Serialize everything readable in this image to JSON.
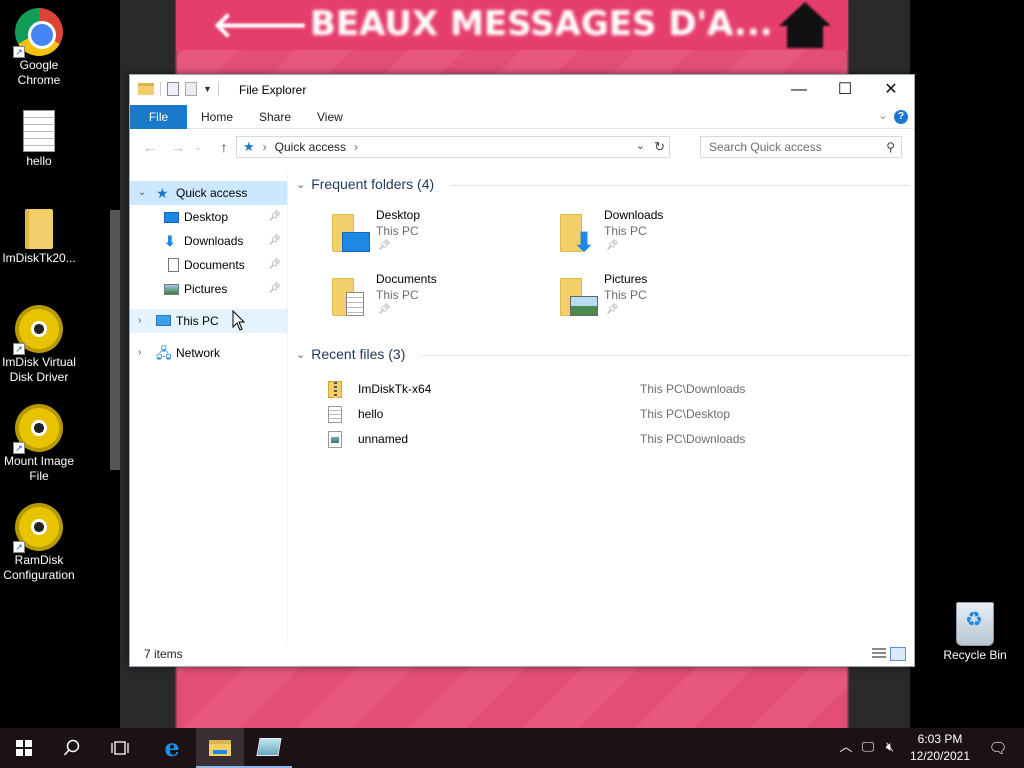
{
  "background": {
    "title": "BEAUX MESSAGES D'A...",
    "back_arrow": "🡐"
  },
  "desktop_icons": [
    {
      "label": "Google Chrome"
    },
    {
      "label": "hello"
    },
    {
      "label": "ImDiskTk20..."
    },
    {
      "label": "ImDisk Virtual Disk Driver"
    },
    {
      "label": "Mount Image File"
    },
    {
      "label": "RamDisk Configuration"
    },
    {
      "label": "Recycle Bin"
    }
  ],
  "window": {
    "title": "File Explorer",
    "ribbon_tabs": [
      "File",
      "Home",
      "Share",
      "View"
    ],
    "address_location": "Quick access",
    "search_placeholder": "Search Quick access",
    "nav_pane": {
      "quick_access": "Quick access",
      "pinned": [
        "Desktop",
        "Downloads",
        "Documents",
        "Pictures"
      ],
      "this_pc": "This PC",
      "network": "Network"
    },
    "frequent_header": "Frequent folders (4)",
    "frequent_folders": [
      {
        "name": "Desktop",
        "location": "This PC"
      },
      {
        "name": "Downloads",
        "location": "This PC"
      },
      {
        "name": "Documents",
        "location": "This PC"
      },
      {
        "name": "Pictures",
        "location": "This PC"
      }
    ],
    "recent_header": "Recent files (3)",
    "recent_files": [
      {
        "name": "ImDiskTk-x64",
        "path": "This PC\\Downloads"
      },
      {
        "name": "hello",
        "path": "This PC\\Desktop"
      },
      {
        "name": "unnamed",
        "path": "This PC\\Downloads"
      }
    ],
    "status": "7 items"
  },
  "taskbar": {
    "time": "6:03 PM",
    "date": "12/20/2021"
  },
  "colors": {
    "accent": "#1979ca",
    "selection": "#cce8ff",
    "taskbar": "#1c1216",
    "bg_pink": "#e34e74"
  }
}
